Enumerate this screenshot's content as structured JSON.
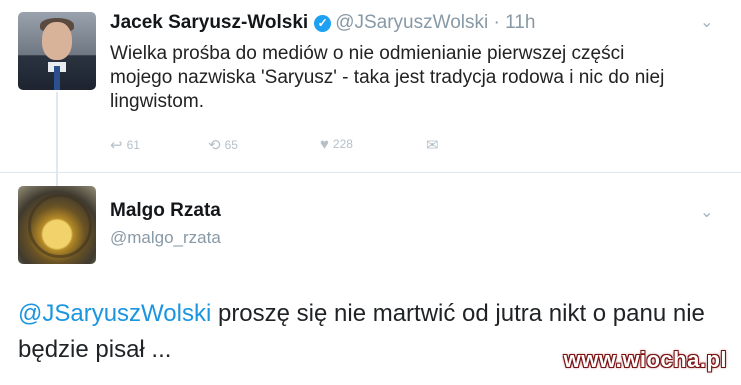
{
  "tweets": [
    {
      "author_name": "Jacek Saryusz-Wolski",
      "verified": true,
      "handle": "@JSaryuszWolski",
      "separator": "·",
      "time": "11h",
      "text": "Wielka prośba do mediów o nie odmienianie pierwszej części mojego nazwiska 'Saryusz' - taka jest tradycja rodowa i nic do niej lingwistom.",
      "actions": {
        "reply_icon": "reply-icon",
        "reply_count": "61",
        "retweet_icon": "retweet-icon",
        "retweet_count": "65",
        "like_icon": "heart-icon",
        "like_count": "228",
        "dm_icon": "direct-message-icon"
      }
    },
    {
      "author_name": "Malgo Rzata",
      "handle": "@malgo_rzata",
      "mention": "@JSaryuszWolski",
      "text": " proszę się nie martwić od jutra nikt o panu nie będzie pisał ..."
    }
  ],
  "watermark": "www.wiocha.pl",
  "colors": {
    "link": "#1b95e0",
    "verified": "#1da1f2",
    "muted": "#8899a6"
  }
}
